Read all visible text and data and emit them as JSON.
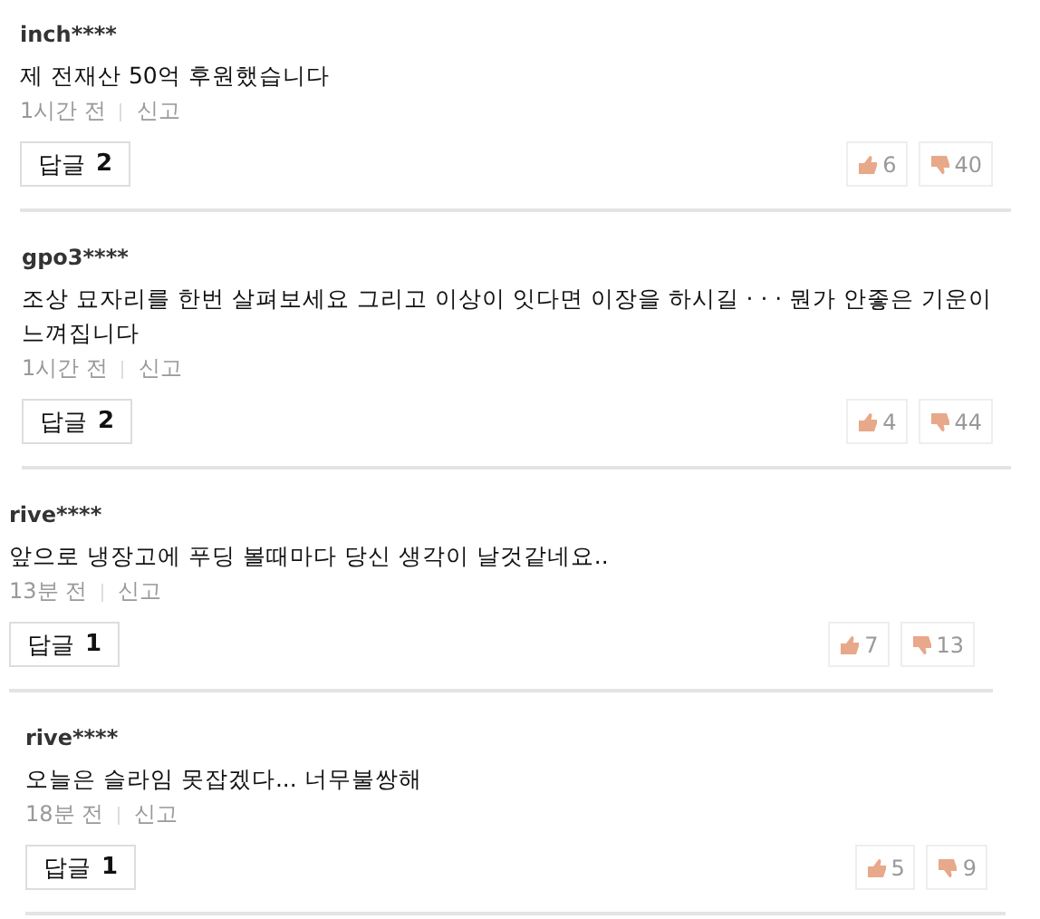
{
  "comments": [
    {
      "author": "inch****",
      "text": "제 전재산 50억 후원했습니다",
      "time": "1시간 전",
      "report": "신고",
      "reply_label": "답글",
      "reply_count": "2",
      "likes": "6",
      "dislikes": "40"
    },
    {
      "author": "gpo3****",
      "text": "조상 묘자리를 한번 살펴보세요 그리고 이상이 잇다면 이장을 하시길 · · · 뭔가 안좋은 기운이 느껴집니다",
      "time": "1시간 전",
      "report": "신고",
      "reply_label": "답글",
      "reply_count": "2",
      "likes": "4",
      "dislikes": "44"
    },
    {
      "author": "rive****",
      "text": "앞으로 냉장고에 푸딩 볼때마다 당신 생각이 날것같네요..",
      "time": "13분 전",
      "report": "신고",
      "reply_label": "답글",
      "reply_count": "1",
      "likes": "7",
      "dislikes": "13"
    },
    {
      "author": "rive****",
      "text": "오늘은 슬라임 못잡겠다... 너무불쌍해",
      "time": "18분 전",
      "report": "신고",
      "reply_label": "답글",
      "reply_count": "1",
      "likes": "5",
      "dislikes": "9"
    }
  ]
}
